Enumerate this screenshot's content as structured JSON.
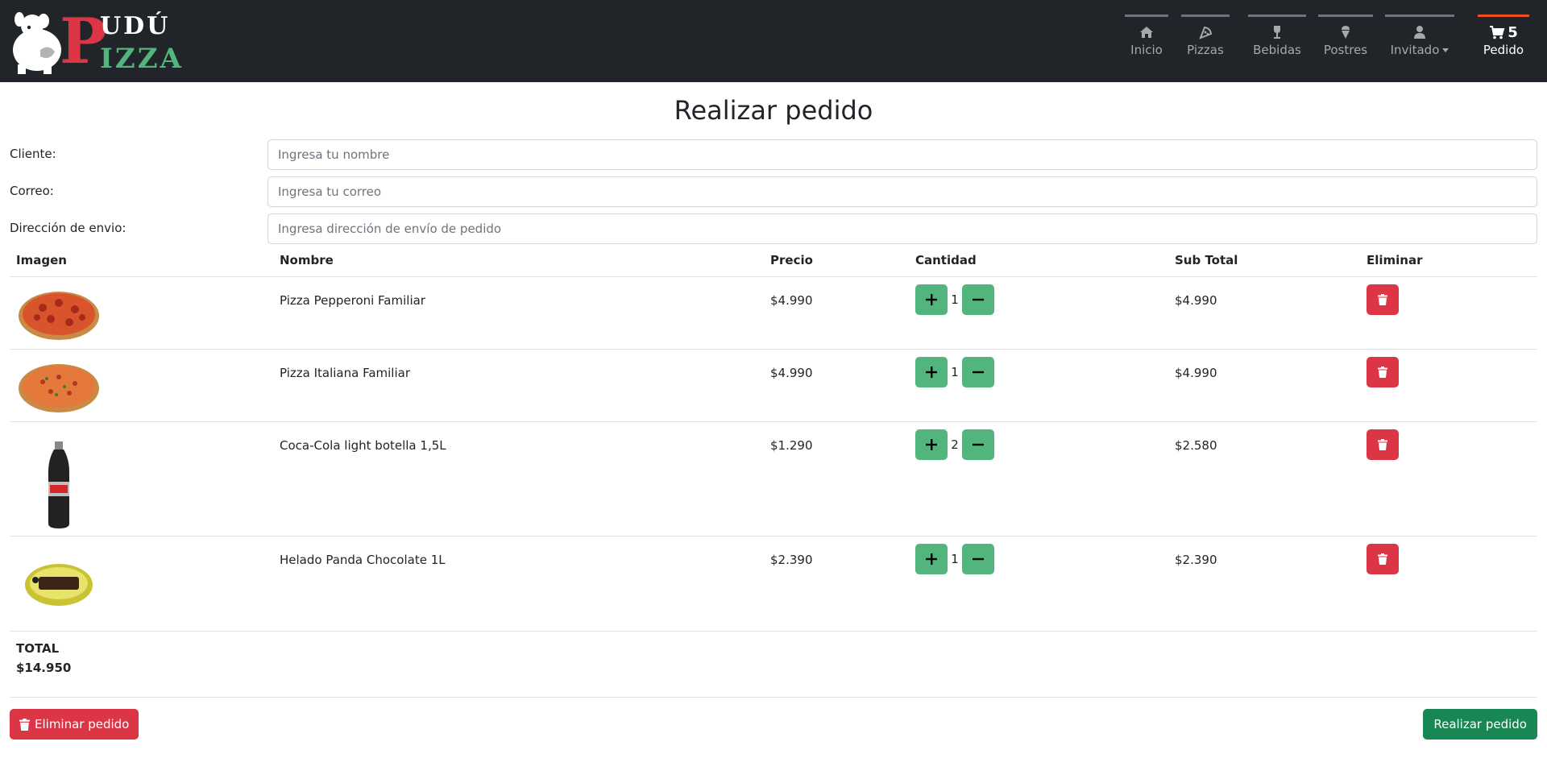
{
  "brand": {
    "top_text": "UDÚ",
    "initial": "P",
    "bottom_text": "IZZA"
  },
  "nav": {
    "items": [
      {
        "label": "Inicio",
        "icon": "home-icon"
      },
      {
        "label": "Pizzas",
        "icon": "pizza-slice-icon"
      },
      {
        "label": "Bebidas",
        "icon": "wine-glass-icon"
      },
      {
        "label": "Postres",
        "icon": "ice-cream-icon"
      },
      {
        "label": "Invitado",
        "icon": "user-icon"
      },
      {
        "label": "Pedido",
        "icon": "cart-icon"
      }
    ],
    "cart_count": "5",
    "active_color": "#e8501f"
  },
  "page": {
    "title": "Realizar pedido"
  },
  "form": {
    "client_label": "Cliente:",
    "client_placeholder": "Ingresa tu nombre",
    "email_label": "Correo:",
    "email_placeholder": "Ingresa tu correo",
    "address_label": "Dirección de envio:",
    "address_placeholder": "Ingresa dirección de envío de pedido"
  },
  "table": {
    "headers": [
      "Imagen",
      "Nombre",
      "Precio",
      "Cantidad",
      "Sub Total",
      "Eliminar"
    ],
    "rows": [
      {
        "name": "Pizza Pepperoni Familiar",
        "price": "$4.990",
        "qty": "1",
        "subtotal": "$4.990",
        "image": "pepperoni-pizza-image"
      },
      {
        "name": "Pizza Italiana Familiar",
        "price": "$4.990",
        "qty": "1",
        "subtotal": "$4.990",
        "image": "italian-pizza-image"
      },
      {
        "name": "Coca-Cola light botella 1,5L",
        "price": "$1.290",
        "qty": "2",
        "subtotal": "$2.580",
        "image": "coca-cola-bottle-image"
      },
      {
        "name": "Helado Panda Chocolate 1L",
        "price": "$2.390",
        "qty": "1",
        "subtotal": "$2.390",
        "image": "ice-cream-tub-image"
      }
    ]
  },
  "summary": {
    "total_label": "TOTAL",
    "total_value": "$14.950"
  },
  "actions": {
    "delete_order": "Eliminar pedido",
    "place_order": "Realizar pedido"
  },
  "colors": {
    "navbar": "#212529",
    "accent_green": "#52b57d",
    "danger": "#dc3545",
    "success": "#198754",
    "brand_red": "#dc3545"
  }
}
